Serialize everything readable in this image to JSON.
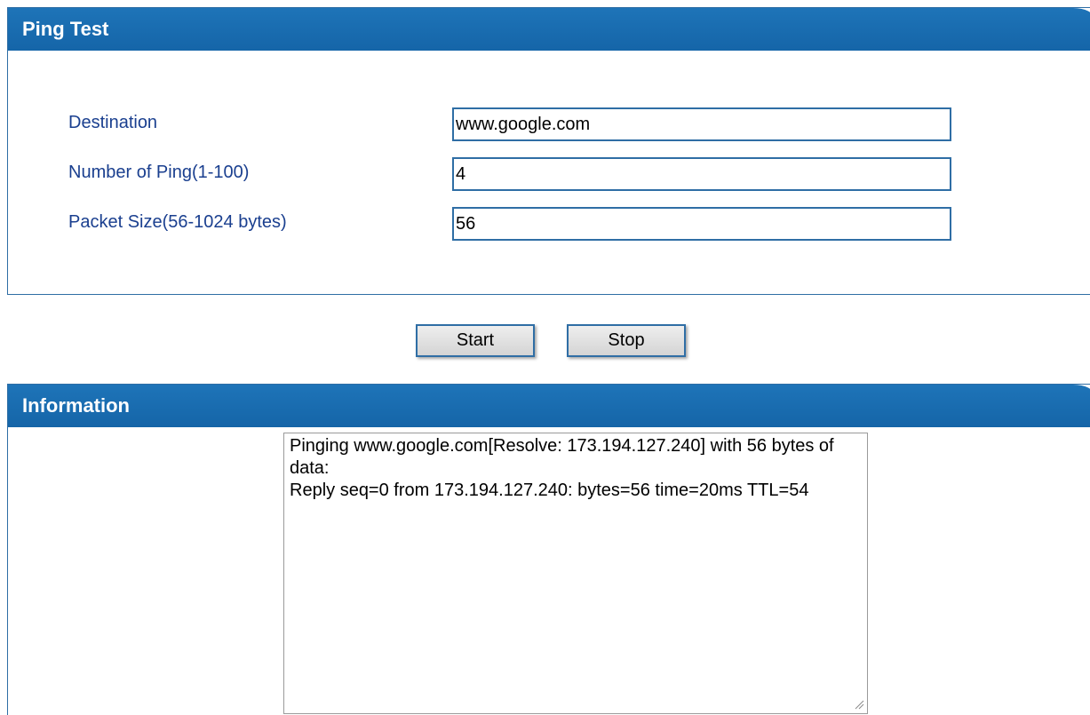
{
  "ping_test": {
    "title": "Ping Test",
    "fields": [
      {
        "label": "Destination",
        "value": "www.google.com"
      },
      {
        "label": "Number of Ping(1-100)",
        "value": "4"
      },
      {
        "label": "Packet Size(56-1024 bytes)",
        "value": "56"
      }
    ]
  },
  "actions": {
    "start_label": "Start",
    "stop_label": "Stop"
  },
  "information": {
    "title": "Information",
    "output": "Pinging www.google.com[Resolve: 173.194.127.240] with 56 bytes of data:\nReply seq=0 from 173.194.127.240: bytes=56 time=20ms TTL=54"
  },
  "colors": {
    "header_bg": "#1565a8",
    "border": "#2f6ea5",
    "label_text": "#1a3f8f"
  },
  "icons": {
    "textarea_grip": "resize-grip-icon"
  }
}
